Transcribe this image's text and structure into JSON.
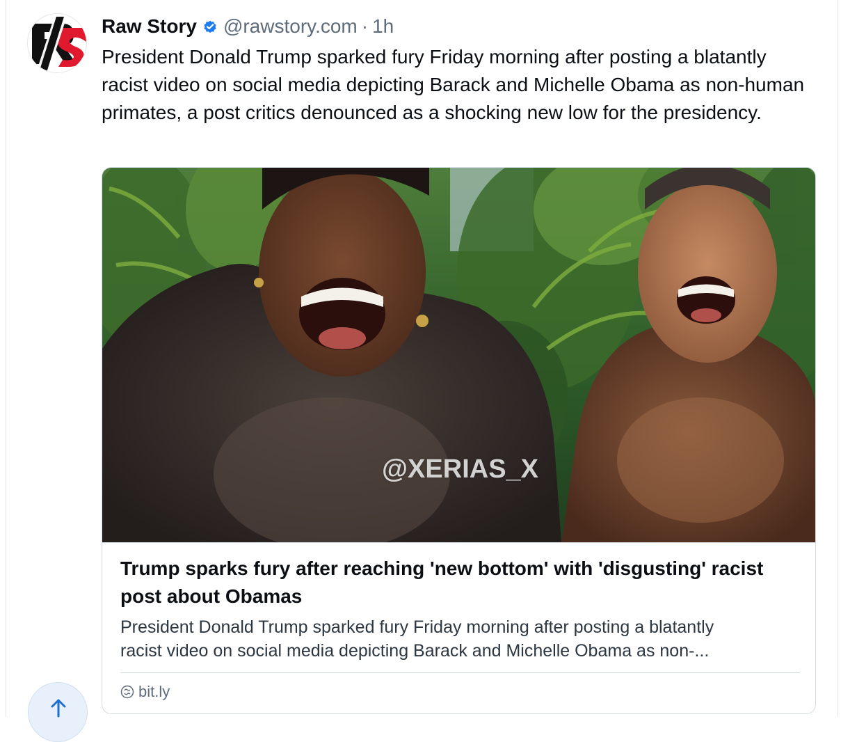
{
  "post": {
    "author_name": "Raw Story",
    "handle": "@rawstory.com",
    "separator": "·",
    "time": "1h",
    "text": "President Donald Trump sparked fury Friday morning after posting a blatantly racist video on social media depicting Barack and Michelle Obama as non-human primates, a post critics denounced as a shocking new low for the presidency.",
    "avatar_letters": "RS"
  },
  "embed": {
    "image_watermark": "@XERIAS_X",
    "title": "Trump sparks fury after reaching 'new bottom' with 'disgusting' racist post about Obamas",
    "description": "President Donald Trump sparked fury Friday morning after posting a blatantly\nracist video on social media depicting Barack and Michelle Obama as non-...",
    "link_domain": "bit.ly"
  },
  "icons": {
    "verified": "verified-check-icon",
    "link": "globe-link-icon",
    "scroll_top": "arrow-up-icon"
  },
  "colors": {
    "verified_blue": "#1d7bf0",
    "avatar_red": "#e0192e",
    "muted_text": "#5d6b7a",
    "scroll_button_bg": "#e8f1fb",
    "scroll_arrow": "#1e6fcf"
  }
}
